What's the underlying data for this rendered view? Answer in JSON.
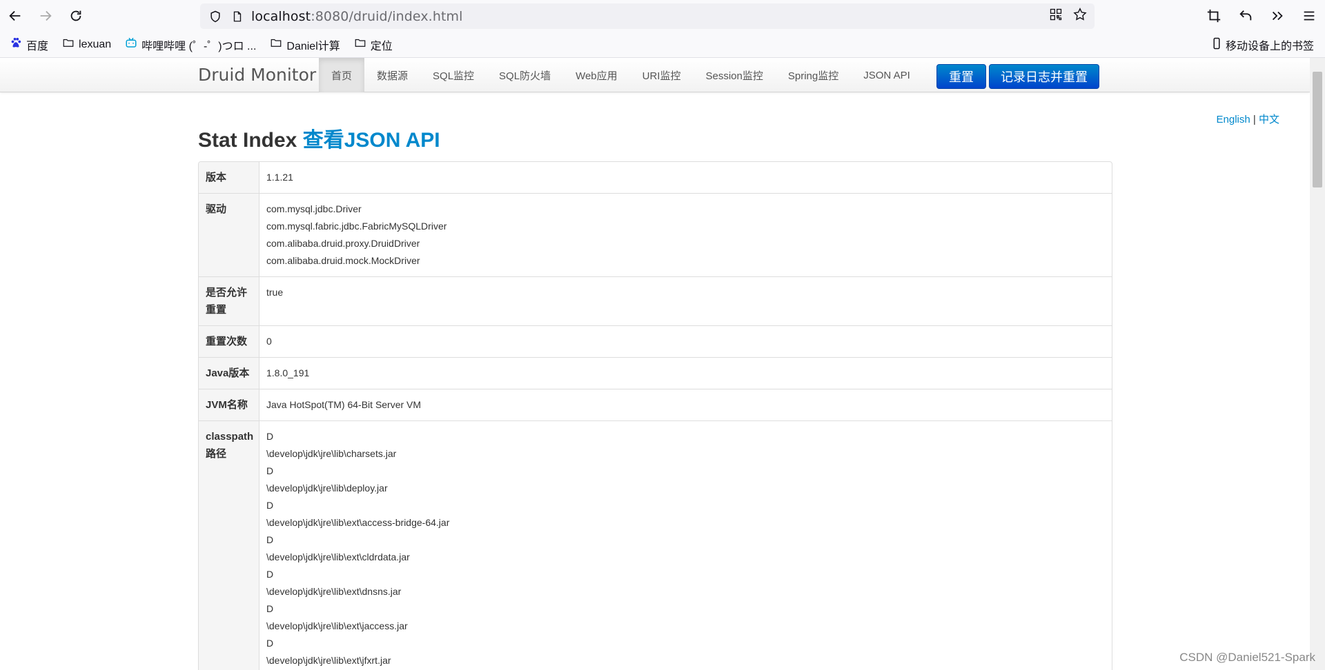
{
  "browser": {
    "url_host": "localhost",
    "url_rest": ":8080/druid/index.html",
    "bookmarks": [
      "百度",
      "lexuan",
      "哔哩哔哩 (゜-゜)つロ ...",
      "Daniel计算",
      "定位"
    ],
    "mobile_bookmarks": "移动设备上的书签"
  },
  "navbar": {
    "brand": "Druid Monitor",
    "items": [
      "首页",
      "数据源",
      "SQL监控",
      "SQL防火墙",
      "Web应用",
      "URI监控",
      "Session监控",
      "Spring监控",
      "JSON API"
    ],
    "reset_label": "重置",
    "log_reset_label": "记录日志并重置"
  },
  "lang": {
    "english": "English",
    "sep": "|",
    "chinese": "中文"
  },
  "title": {
    "prefix": "Stat Index",
    "link": "查看JSON API"
  },
  "stats": [
    {
      "key": "版本",
      "values": [
        "1.1.21"
      ]
    },
    {
      "key": "驱动",
      "values": [
        "com.mysql.jdbc.Driver",
        "com.mysql.fabric.jdbc.FabricMySQLDriver",
        "com.alibaba.druid.proxy.DruidDriver",
        "com.alibaba.druid.mock.MockDriver"
      ]
    },
    {
      "key": "是否允许重置",
      "values": [
        "true"
      ]
    },
    {
      "key": "重置次数",
      "values": [
        "0"
      ]
    },
    {
      "key": "Java版本",
      "values": [
        "1.8.0_191"
      ]
    },
    {
      "key": "JVM名称",
      "values": [
        "Java HotSpot(TM) 64-Bit Server VM"
      ]
    },
    {
      "key": "classpath路径",
      "values": [
        "D",
        "\\develop\\jdk\\jre\\lib\\charsets.jar",
        "D",
        "\\develop\\jdk\\jre\\lib\\deploy.jar",
        "D",
        "\\develop\\jdk\\jre\\lib\\ext\\access-bridge-64.jar",
        "D",
        "\\develop\\jdk\\jre\\lib\\ext\\cldrdata.jar",
        "D",
        "\\develop\\jdk\\jre\\lib\\ext\\dnsns.jar",
        "D",
        "\\develop\\jdk\\jre\\lib\\ext\\jaccess.jar",
        "D",
        "\\develop\\jdk\\jre\\lib\\ext\\jfxrt.jar"
      ]
    }
  ],
  "watermark": "CSDN @Daniel521-Spark"
}
